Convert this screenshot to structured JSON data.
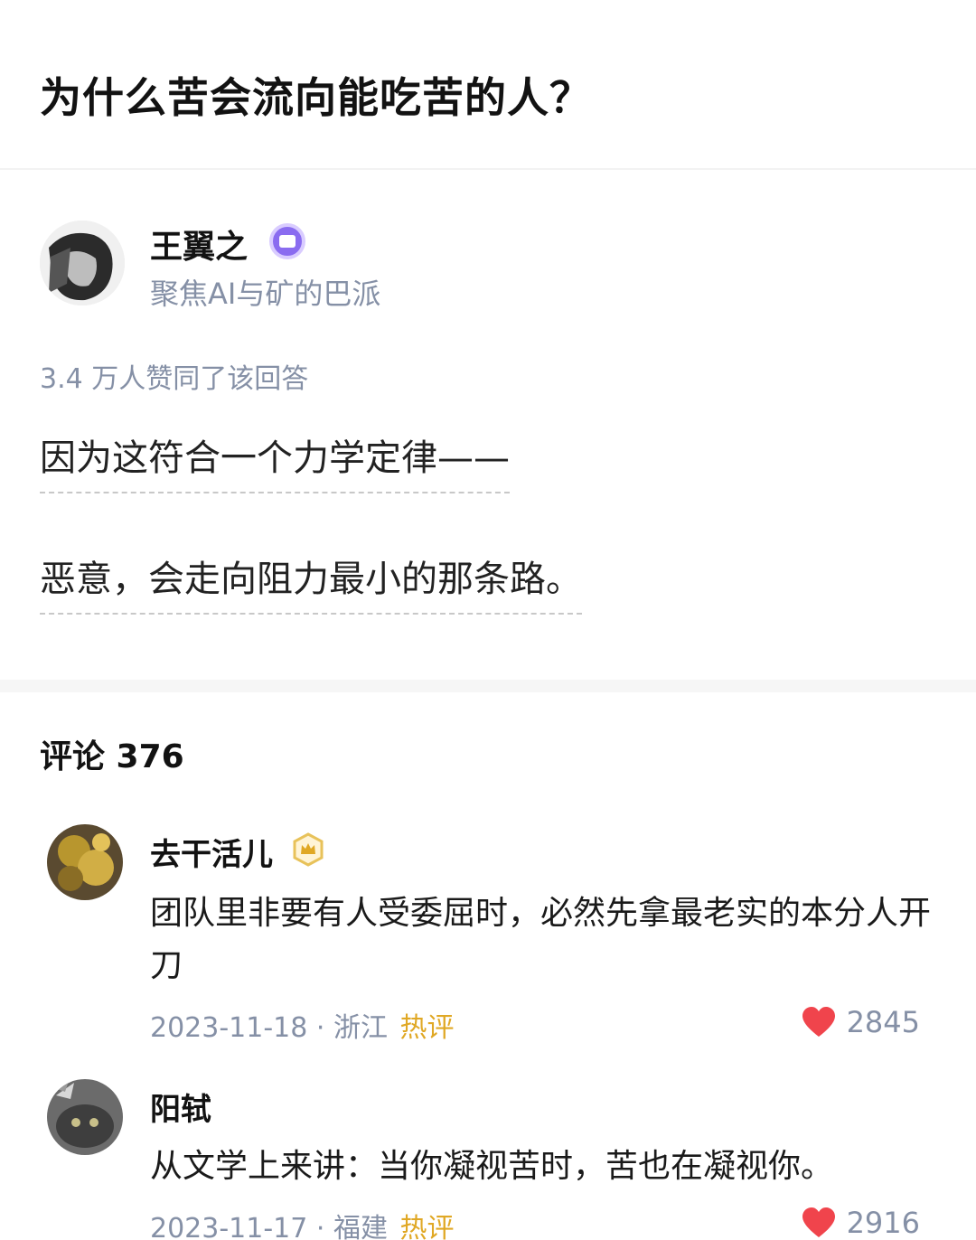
{
  "question": {
    "title": "为什么苦会流向能吃苦的人？"
  },
  "author": {
    "name": "王翼之",
    "bio": "聚焦AI与矿的巴派"
  },
  "answer": {
    "upvotes": "3.4 万人赞同了该回答",
    "line1": "因为这符合一个力学定律——",
    "line2": "恶意，会走向阻力最小的那条路。"
  },
  "comments": {
    "header": "评论 376",
    "items": [
      {
        "name": "去干活儿",
        "text": "团队里非要有人受委屈时，必然先拿最老实的本分人开刀",
        "date": "2023-11-18",
        "sep": "·",
        "location": "浙江",
        "tag": "热评",
        "likes": "2845"
      },
      {
        "name": "阳轼",
        "text": "从文学上来讲：当你凝视苦时，苦也在凝视你。",
        "date": "2023-11-17",
        "sep": "·",
        "location": "福建",
        "tag": "热评",
        "likes": "2916"
      }
    ]
  },
  "colors": {
    "hot_tag": "#e0a825",
    "heart": "#f0444c",
    "meta": "#8590a6",
    "verified": "#8a6cf0"
  }
}
